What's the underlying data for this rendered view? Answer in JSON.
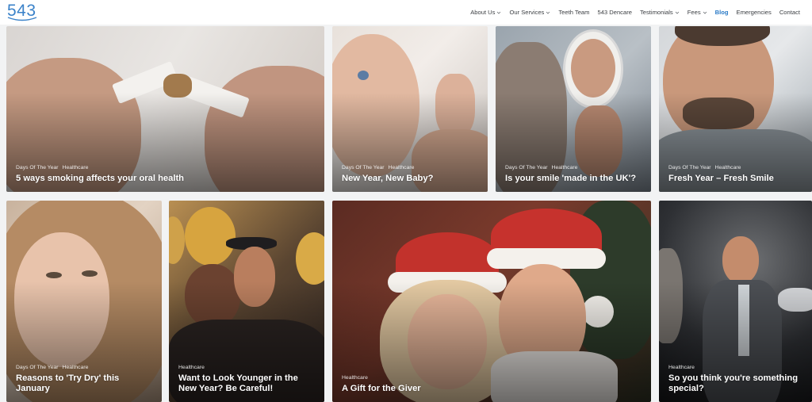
{
  "brand": {
    "logo_text": "543",
    "logo_color": "#3a82c9"
  },
  "nav": {
    "items": [
      {
        "label": "About Us",
        "has_dropdown": true,
        "active": false
      },
      {
        "label": "Our Services",
        "has_dropdown": true,
        "active": false
      },
      {
        "label": "Teeth Team",
        "has_dropdown": false,
        "active": false
      },
      {
        "label": "543 Dencare",
        "has_dropdown": false,
        "active": false
      },
      {
        "label": "Testimonials",
        "has_dropdown": true,
        "active": false
      },
      {
        "label": "Fees",
        "has_dropdown": true,
        "active": false
      },
      {
        "label": "Blog",
        "has_dropdown": false,
        "active": true
      },
      {
        "label": "Emergencies",
        "has_dropdown": false,
        "active": false
      },
      {
        "label": "Contact",
        "has_dropdown": false,
        "active": false
      }
    ],
    "active_color": "#2b7bc7"
  },
  "posts": [
    {
      "tags": [
        "Days Of The Year",
        "Healthcare"
      ],
      "title": "5 ways smoking affects your oral health",
      "image": "hands-breaking-cigarette"
    },
    {
      "tags": [
        "Days Of The Year",
        "Healthcare"
      ],
      "title": "New Year, New Baby?",
      "image": "smiling-baby"
    },
    {
      "tags": [
        "Days Of The Year",
        "Healthcare"
      ],
      "title": "Is your smile 'made in the UK'?",
      "image": "man-smiling-in-mirror"
    },
    {
      "tags": [
        "Days Of The Year",
        "Healthcare"
      ],
      "title": "Fresh Year – Fresh Smile",
      "image": "smiling-bearded-man"
    },
    {
      "tags": [
        "Days Of The Year",
        "Healthcare"
      ],
      "title": "Reasons to 'Try Dry' this January",
      "image": "woman-smiling"
    },
    {
      "tags": [
        "Healthcare"
      ],
      "title": "Want to Look Younger in the New Year? Be Careful!",
      "image": "couple-party-balloons"
    },
    {
      "tags": [
        "Healthcare"
      ],
      "title": "A Gift for the Giver",
      "image": "senior-couple-santa-hats"
    },
    {
      "tags": [
        "Healthcare"
      ],
      "title": "So you think you're something special?",
      "image": "man-with-microphones"
    }
  ]
}
